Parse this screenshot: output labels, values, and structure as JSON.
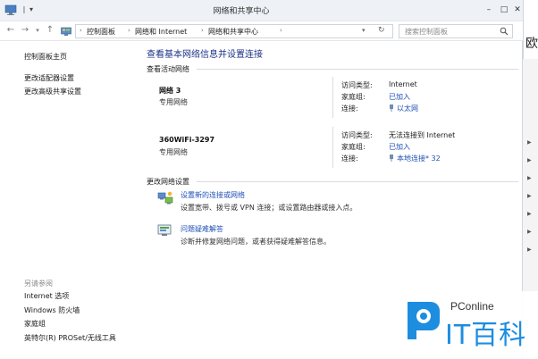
{
  "window": {
    "title": "网络和共享中心"
  },
  "address": {
    "segments": [
      "控制面板",
      "网络和 Internet",
      "网络和共享中心"
    ],
    "search_placeholder": "搜索控制面板"
  },
  "sidebar": {
    "items": [
      "控制面板主页",
      "更改适配器设置",
      "更改高级共享设置"
    ],
    "see_also_label": "另请参阅",
    "see_also": [
      "Internet 选项",
      "Windows 防火墙",
      "家庭组",
      "英特尔(R) PROSet/无线工具"
    ]
  },
  "main": {
    "title": "查看基本网络信息并设置连接",
    "active_label": "查看活动网络",
    "networks": [
      {
        "name": "网络  3",
        "type": "专用网络",
        "access_key": "访问类型:",
        "access_val": "Internet",
        "homegroup_key": "家庭组:",
        "homegroup_val": "已加入",
        "conn_key": "连接:",
        "conn_val": "以太网"
      },
      {
        "name": "360WiFi-3297",
        "type": "专用网络",
        "access_key": "访问类型:",
        "access_val": "无法连接到 Internet",
        "homegroup_key": "家庭组:",
        "homegroup_val": "已加入",
        "conn_key": "连接:",
        "conn_val": "本地连接* 32"
      }
    ],
    "change_label": "更改网络设置",
    "tasks": [
      {
        "link": "设置新的连接或网络",
        "desc": "设置宽带、拨号或 VPN 连接；或设置路由器或接入点。"
      },
      {
        "link": "问题疑难解答",
        "desc": "诊断并修复网络问题，或者获得疑难解答信息。"
      }
    ]
  },
  "edge": {
    "char": "欧"
  },
  "watermark": {
    "brand": "PConline",
    "text": "IT百科"
  },
  "colors": {
    "link": "#1f4fb5",
    "title": "#1e3287",
    "titlebar": "#eef2f6",
    "brand_blue": "#1d8de0"
  }
}
